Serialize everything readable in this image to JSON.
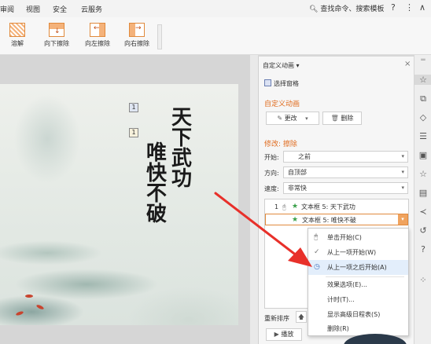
{
  "menubar": {
    "items": [
      "审阅",
      "视图",
      "安全",
      "云服务"
    ],
    "search_label": "查找命令、搜索模板",
    "help_icon": "?",
    "more_icon": "⋮",
    "collapse_icon": "∧"
  },
  "toolbar": {
    "buttons": [
      {
        "label": "溶解",
        "icon": "dissolve-icon"
      },
      {
        "label": "向下擦除",
        "icon": "wipe-down-icon"
      },
      {
        "label": "向左擦除",
        "icon": "wipe-left-icon"
      },
      {
        "label": "向右擦除",
        "icon": "wipe-right-icon"
      }
    ]
  },
  "slide": {
    "text_line1": [
      "天",
      "下",
      "武",
      "功"
    ],
    "text_line2": [
      "唯",
      "快",
      "不",
      "破"
    ],
    "tag1": "1",
    "tag2": "1"
  },
  "panel": {
    "title": "自定义动画",
    "close_icon": "×",
    "select_pane_label": "选择窗格",
    "section_title": "自定义动画",
    "change_label": "更改",
    "delete_label": "删除",
    "modify_label": "修改: 擦除",
    "start_label": "开始:",
    "start_value": "之前",
    "direction_label": "方向:",
    "direction_value": "自顶部",
    "speed_label": "速度:",
    "speed_value": "非常快",
    "list": [
      {
        "num": "1",
        "text": "文本框 5: 天下武功"
      },
      {
        "num": "",
        "text": "文本框 5:        唯快不破"
      }
    ],
    "reorder_label": "重新排序",
    "play_label": "播放"
  },
  "context_menu": {
    "items": [
      {
        "label": "单击开始(C)",
        "icon": "mouse-icon"
      },
      {
        "label": "从上一项开始(W)",
        "icon": "check-icon"
      },
      {
        "label": "从上一项之后开始(A)",
        "icon": "clock-icon"
      },
      {
        "label": "效果选项(E)...",
        "icon": ""
      },
      {
        "label": "计时(T)...",
        "icon": ""
      },
      {
        "label": "显示高级日程表(S)",
        "icon": ""
      },
      {
        "label": "删除(R)",
        "icon": ""
      }
    ]
  },
  "colors": {
    "accent": "#e06c1f",
    "arrow": "#e8302a",
    "highlight": "#e3eefb"
  }
}
